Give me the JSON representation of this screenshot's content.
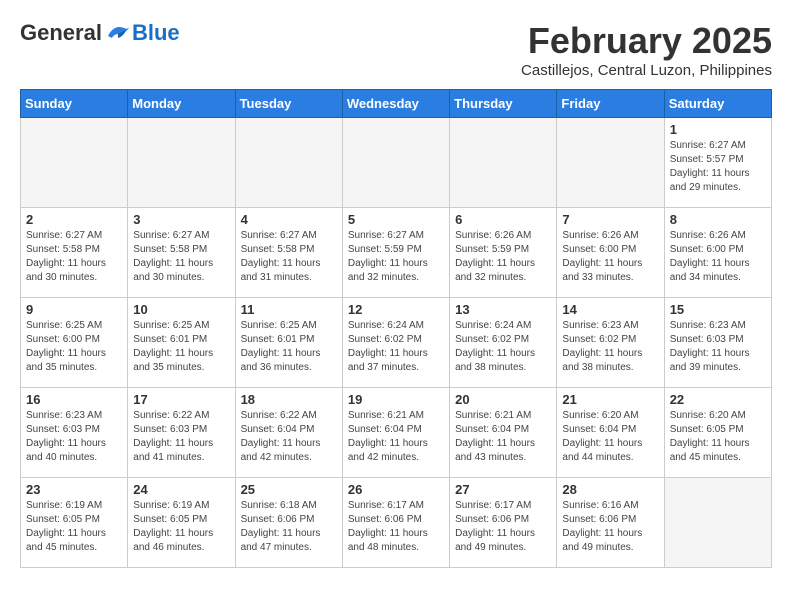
{
  "header": {
    "logo_general": "General",
    "logo_blue": "Blue",
    "month_title": "February 2025",
    "location": "Castillejos, Central Luzon, Philippines"
  },
  "weekdays": [
    "Sunday",
    "Monday",
    "Tuesday",
    "Wednesday",
    "Thursday",
    "Friday",
    "Saturday"
  ],
  "weeks": [
    [
      {
        "day": "",
        "info": ""
      },
      {
        "day": "",
        "info": ""
      },
      {
        "day": "",
        "info": ""
      },
      {
        "day": "",
        "info": ""
      },
      {
        "day": "",
        "info": ""
      },
      {
        "day": "",
        "info": ""
      },
      {
        "day": "1",
        "info": "Sunrise: 6:27 AM\nSunset: 5:57 PM\nDaylight: 11 hours and 29 minutes."
      }
    ],
    [
      {
        "day": "2",
        "info": "Sunrise: 6:27 AM\nSunset: 5:58 PM\nDaylight: 11 hours and 30 minutes."
      },
      {
        "day": "3",
        "info": "Sunrise: 6:27 AM\nSunset: 5:58 PM\nDaylight: 11 hours and 30 minutes."
      },
      {
        "day": "4",
        "info": "Sunrise: 6:27 AM\nSunset: 5:58 PM\nDaylight: 11 hours and 31 minutes."
      },
      {
        "day": "5",
        "info": "Sunrise: 6:27 AM\nSunset: 5:59 PM\nDaylight: 11 hours and 32 minutes."
      },
      {
        "day": "6",
        "info": "Sunrise: 6:26 AM\nSunset: 5:59 PM\nDaylight: 11 hours and 32 minutes."
      },
      {
        "day": "7",
        "info": "Sunrise: 6:26 AM\nSunset: 6:00 PM\nDaylight: 11 hours and 33 minutes."
      },
      {
        "day": "8",
        "info": "Sunrise: 6:26 AM\nSunset: 6:00 PM\nDaylight: 11 hours and 34 minutes."
      }
    ],
    [
      {
        "day": "9",
        "info": "Sunrise: 6:25 AM\nSunset: 6:00 PM\nDaylight: 11 hours and 35 minutes."
      },
      {
        "day": "10",
        "info": "Sunrise: 6:25 AM\nSunset: 6:01 PM\nDaylight: 11 hours and 35 minutes."
      },
      {
        "day": "11",
        "info": "Sunrise: 6:25 AM\nSunset: 6:01 PM\nDaylight: 11 hours and 36 minutes."
      },
      {
        "day": "12",
        "info": "Sunrise: 6:24 AM\nSunset: 6:02 PM\nDaylight: 11 hours and 37 minutes."
      },
      {
        "day": "13",
        "info": "Sunrise: 6:24 AM\nSunset: 6:02 PM\nDaylight: 11 hours and 38 minutes."
      },
      {
        "day": "14",
        "info": "Sunrise: 6:23 AM\nSunset: 6:02 PM\nDaylight: 11 hours and 38 minutes."
      },
      {
        "day": "15",
        "info": "Sunrise: 6:23 AM\nSunset: 6:03 PM\nDaylight: 11 hours and 39 minutes."
      }
    ],
    [
      {
        "day": "16",
        "info": "Sunrise: 6:23 AM\nSunset: 6:03 PM\nDaylight: 11 hours and 40 minutes."
      },
      {
        "day": "17",
        "info": "Sunrise: 6:22 AM\nSunset: 6:03 PM\nDaylight: 11 hours and 41 minutes."
      },
      {
        "day": "18",
        "info": "Sunrise: 6:22 AM\nSunset: 6:04 PM\nDaylight: 11 hours and 42 minutes."
      },
      {
        "day": "19",
        "info": "Sunrise: 6:21 AM\nSunset: 6:04 PM\nDaylight: 11 hours and 42 minutes."
      },
      {
        "day": "20",
        "info": "Sunrise: 6:21 AM\nSunset: 6:04 PM\nDaylight: 11 hours and 43 minutes."
      },
      {
        "day": "21",
        "info": "Sunrise: 6:20 AM\nSunset: 6:04 PM\nDaylight: 11 hours and 44 minutes."
      },
      {
        "day": "22",
        "info": "Sunrise: 6:20 AM\nSunset: 6:05 PM\nDaylight: 11 hours and 45 minutes."
      }
    ],
    [
      {
        "day": "23",
        "info": "Sunrise: 6:19 AM\nSunset: 6:05 PM\nDaylight: 11 hours and 45 minutes."
      },
      {
        "day": "24",
        "info": "Sunrise: 6:19 AM\nSunset: 6:05 PM\nDaylight: 11 hours and 46 minutes."
      },
      {
        "day": "25",
        "info": "Sunrise: 6:18 AM\nSunset: 6:06 PM\nDaylight: 11 hours and 47 minutes."
      },
      {
        "day": "26",
        "info": "Sunrise: 6:17 AM\nSunset: 6:06 PM\nDaylight: 11 hours and 48 minutes."
      },
      {
        "day": "27",
        "info": "Sunrise: 6:17 AM\nSunset: 6:06 PM\nDaylight: 11 hours and 49 minutes."
      },
      {
        "day": "28",
        "info": "Sunrise: 6:16 AM\nSunset: 6:06 PM\nDaylight: 11 hours and 49 minutes."
      },
      {
        "day": "",
        "info": ""
      }
    ]
  ]
}
